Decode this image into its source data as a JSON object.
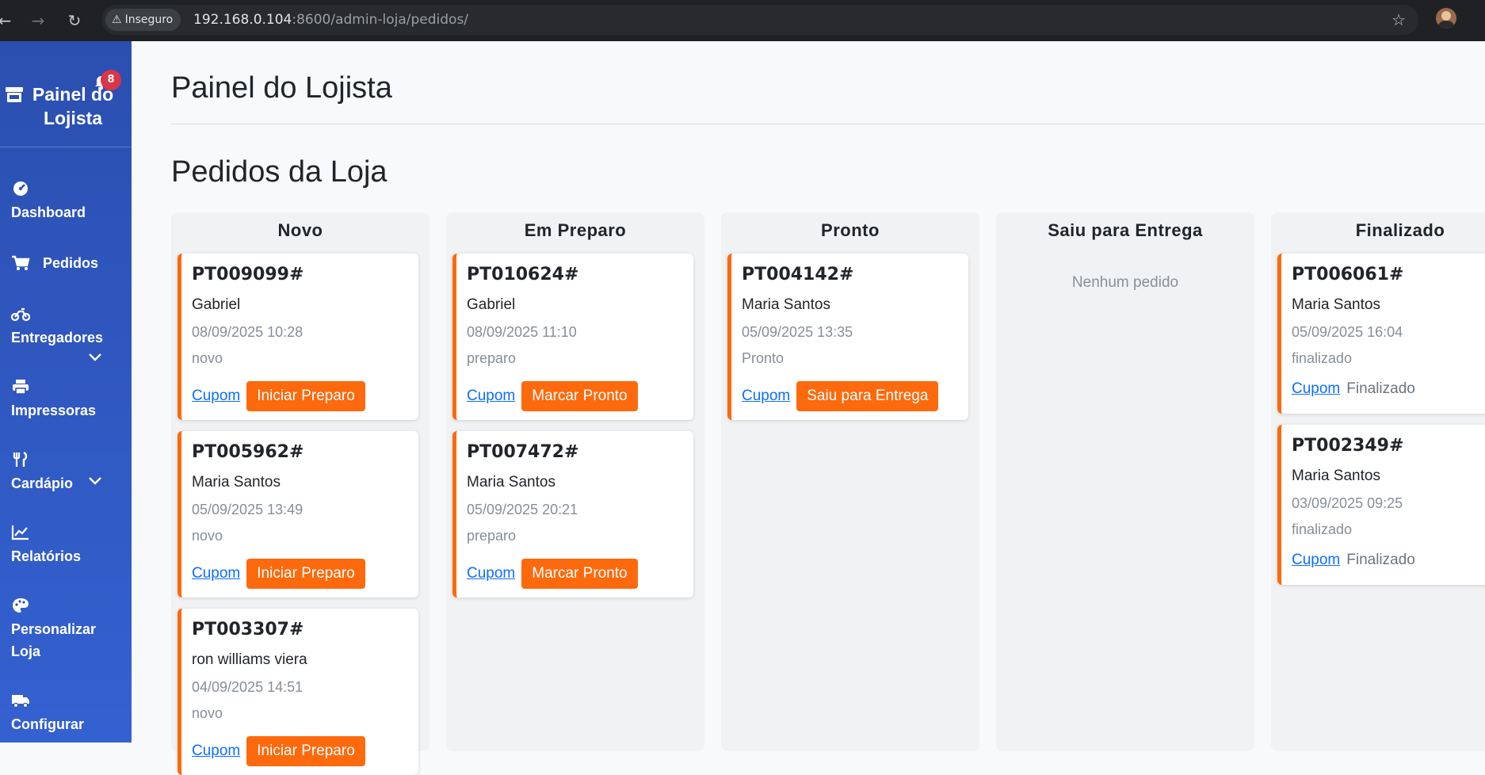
{
  "browser": {
    "security_label": "Inseguro",
    "url_host": "192.168.0.104",
    "url_path": ":8600/admin-loja/pedidos/"
  },
  "sidebar": {
    "brand_title": "Painel do Lojista",
    "notification_count": "8",
    "items": [
      {
        "label": "Dashboard"
      },
      {
        "label": "Pedidos"
      },
      {
        "label": "Entregadores"
      },
      {
        "label": "Impressoras"
      },
      {
        "label": "Cardápio"
      },
      {
        "label": "Relatórios"
      },
      {
        "label": "Personalizar Loja"
      },
      {
        "label": "Configurar"
      }
    ]
  },
  "main": {
    "page_title": "Painel do Lojista",
    "section_title": "Pedidos da Loja",
    "columns": [
      {
        "title": "Novo",
        "cards": [
          {
            "code": "PT009099#",
            "name": "Gabriel",
            "date": "08/09/2025 10:28",
            "status": "novo",
            "coupon": "Cupom",
            "action": "Iniciar Preparo"
          },
          {
            "code": "PT005962#",
            "name": "Maria Santos",
            "date": "05/09/2025 13:49",
            "status": "novo",
            "coupon": "Cupom",
            "action": "Iniciar Preparo"
          },
          {
            "code": "PT003307#",
            "name": "ron williams viera",
            "date": "04/09/2025 14:51",
            "status": "novo",
            "coupon": "Cupom",
            "action": "Iniciar Preparo"
          }
        ]
      },
      {
        "title": "Em Preparo",
        "cards": [
          {
            "code": "PT010624#",
            "name": "Gabriel",
            "date": "08/09/2025 11:10",
            "status": "preparo",
            "coupon": "Cupom",
            "action": "Marcar Pronto"
          },
          {
            "code": "PT007472#",
            "name": "Maria Santos",
            "date": "05/09/2025 20:21",
            "status": "preparo",
            "coupon": "Cupom",
            "action": "Marcar Pronto"
          }
        ]
      },
      {
        "title": "Pronto",
        "cards": [
          {
            "code": "PT004142#",
            "name": "Maria Santos",
            "date": "05/09/2025 13:35",
            "status": "Pronto",
            "coupon": "Cupom",
            "action": "Saiu para Entrega"
          }
        ]
      },
      {
        "title": "Saiu para Entrega",
        "empty_text": "Nenhum pedido"
      },
      {
        "title": "Finalizado",
        "cards": [
          {
            "code": "PT006061#",
            "name": "Maria Santos",
            "date": "05/09/2025 16:04",
            "status": "finalizado",
            "coupon": "Cupom",
            "final": "Finalizado"
          },
          {
            "code": "PT002349#",
            "name": "Maria Santos",
            "date": "03/09/2025 09:25",
            "status": "finalizado",
            "coupon": "Cupom",
            "final": "Finalizado"
          }
        ]
      }
    ]
  },
  "colors": {
    "accent": "#fd6a0d",
    "sidebar_top": "#2b4fb0",
    "sidebar_bottom": "#3461d1",
    "badge": "#dc3545",
    "link": "#0d6efd"
  }
}
